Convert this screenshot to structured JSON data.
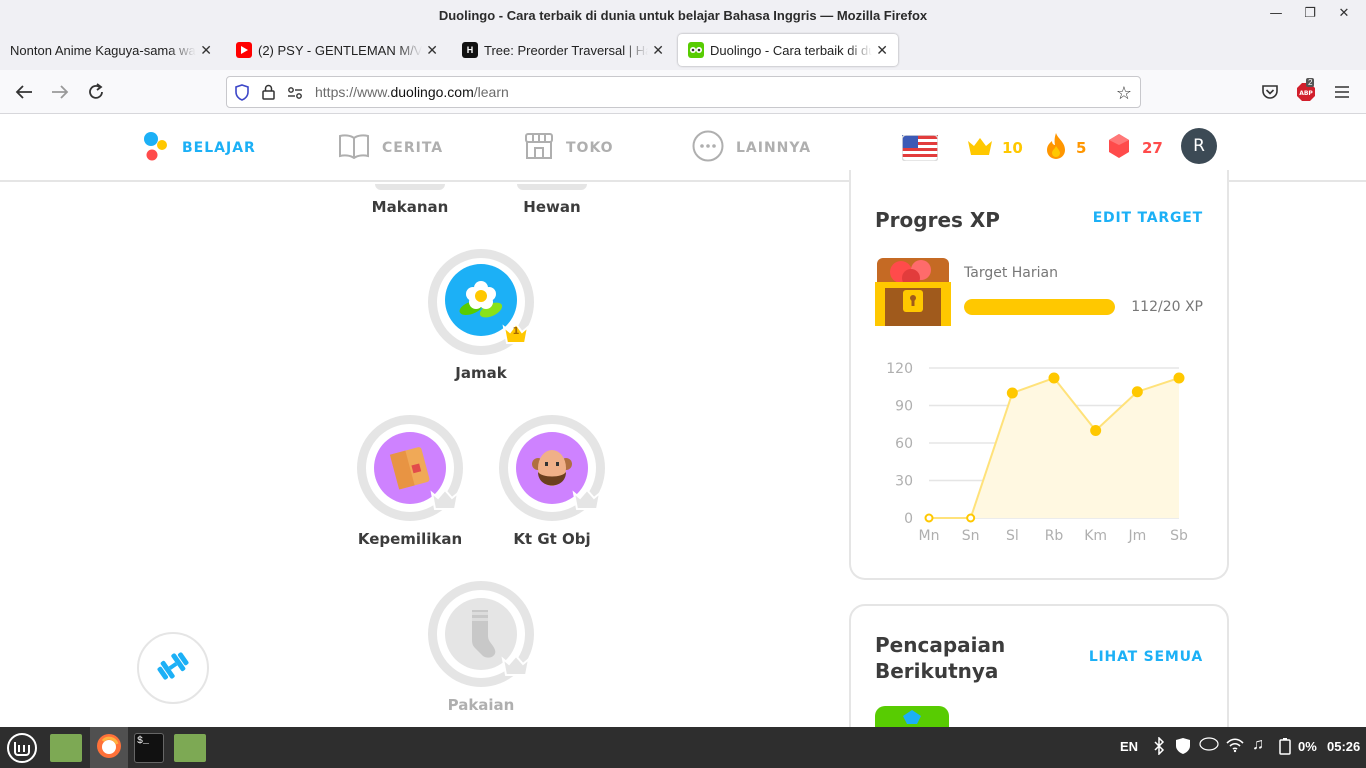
{
  "window": {
    "title": "Duolingo - Cara terbaik di dunia untuk belajar Bahasa Inggris — Mozilla Firefox"
  },
  "tabs": [
    {
      "label": "Nonton Anime Kaguya-sama wa"
    },
    {
      "label": "(2) PSY - GENTLEMAN M/V"
    },
    {
      "label": "Tree: Preorder Traversal | Ha"
    },
    {
      "label": "Duolingo - Cara terbaik di du"
    }
  ],
  "urlbar": {
    "prefix": "https://www.",
    "domain": "duolingo.com",
    "path": "/learn"
  },
  "toolbar": {
    "abp_badge": "2"
  },
  "header": {
    "nav": [
      {
        "label": "BELAJAR"
      },
      {
        "label": "CERITA"
      },
      {
        "label": "TOKO"
      },
      {
        "label": "LAINNYA"
      }
    ],
    "crowns": "10",
    "streak": "5",
    "gems": "27",
    "avatar_initial": "R"
  },
  "skills": {
    "makanan": "Makanan",
    "hewan": "Hewan",
    "jamak": "Jamak",
    "jamak_level": "1",
    "kepemilikan": "Kepemilikan",
    "ktgtobj": "Kt Gt Obj",
    "pakaian": "Pakaian"
  },
  "xp_card": {
    "title": "Progres XP",
    "edit_link": "EDIT TARGET",
    "goal_label": "Target Harian",
    "goal_value": "112/20 XP",
    "goal_progress": 1.0
  },
  "chart_data": {
    "type": "area",
    "categories": [
      "Mn",
      "Sn",
      "Sl",
      "Rb",
      "Km",
      "Jm",
      "Sb"
    ],
    "values": [
      0,
      0,
      100,
      112,
      70,
      101,
      112
    ],
    "yticks": [
      0,
      30,
      60,
      90,
      120
    ],
    "ylim": [
      0,
      120
    ],
    "color": "#ffc800",
    "fill": "#fff8e1",
    "grid": true
  },
  "achievements_card": {
    "title_line1": "Pencapaian",
    "title_line2": "Berikutnya",
    "link": "LIHAT SEMUA"
  },
  "taskbar": {
    "lang": "EN",
    "battery": "0%",
    "clock": "05:26"
  },
  "colors": {
    "accent": "#1cb0f6",
    "gold": "#ffc800",
    "streak": "#ff9600",
    "gem": "#ff4b4b"
  }
}
